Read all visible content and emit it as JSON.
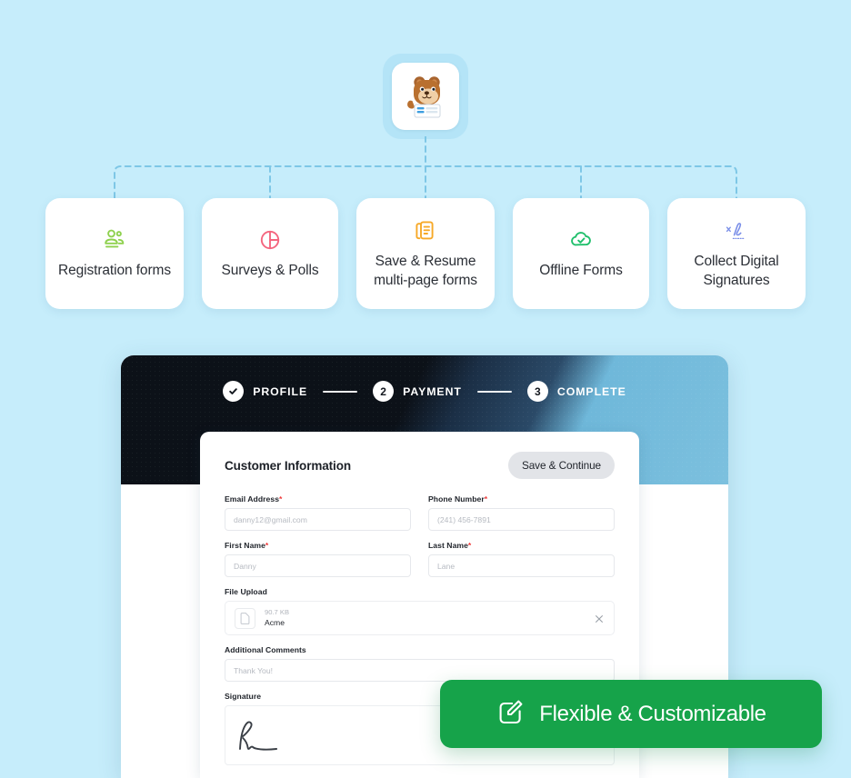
{
  "background_color": "#c6edfb",
  "hero": {
    "avatar_icon": "bear-mascot-form-icon",
    "tile_color": "#b4e4f7"
  },
  "connector": {
    "icon": "dashed-tree-connector",
    "color": "#7ec7e6"
  },
  "features": [
    {
      "label": "Registration forms",
      "icon": "users-group-icon",
      "color": "#8fd14f"
    },
    {
      "label": "Surveys & Polls",
      "icon": "pie-chart-icon",
      "color": "#f4667f"
    },
    {
      "label": "Save & Resume multi-page forms",
      "icon": "documents-stack-icon",
      "color": "#f7a928"
    },
    {
      "label": "Offline Forms",
      "icon": "cloud-check-icon",
      "color": "#1fbf6b"
    },
    {
      "label": "Collect Digital Signatures",
      "icon": "signature-icon",
      "color": "#7b8fe8"
    }
  ],
  "mockup": {
    "stepper": {
      "steps": [
        {
          "marker": "check-icon",
          "label": "PROFILE",
          "state": "completed"
        },
        {
          "marker": "2",
          "label": "PAYMENT",
          "state": "current"
        },
        {
          "marker": "3",
          "label": "COMPLETE",
          "state": "upcoming"
        }
      ]
    },
    "form": {
      "title": "Customer Information",
      "save_label": "Save & Continue",
      "fields": {
        "email": {
          "label": "Email Address",
          "required": "*",
          "placeholder": "danny12@gmail.com"
        },
        "phone": {
          "label": "Phone Number",
          "required": "*",
          "placeholder": "(241) 456-7891"
        },
        "first": {
          "label": "First Name",
          "required": "*",
          "placeholder": "Danny"
        },
        "last": {
          "label": "Last Name",
          "required": "*",
          "placeholder": "Lane"
        },
        "upload": {
          "label": "File Upload",
          "file_size": "90.7 KB",
          "file_name": "Acme",
          "file_icon": "file-icon",
          "remove_icon": "close-icon"
        },
        "comments": {
          "label": "Additional Comments",
          "placeholder": "Thank You!"
        },
        "signature": {
          "label": "Signature",
          "icon": "handwritten-signature-icon"
        }
      }
    }
  },
  "badge": {
    "label": "Flexible & Customizable",
    "icon": "edit-square-icon",
    "color": "#16a34a"
  }
}
